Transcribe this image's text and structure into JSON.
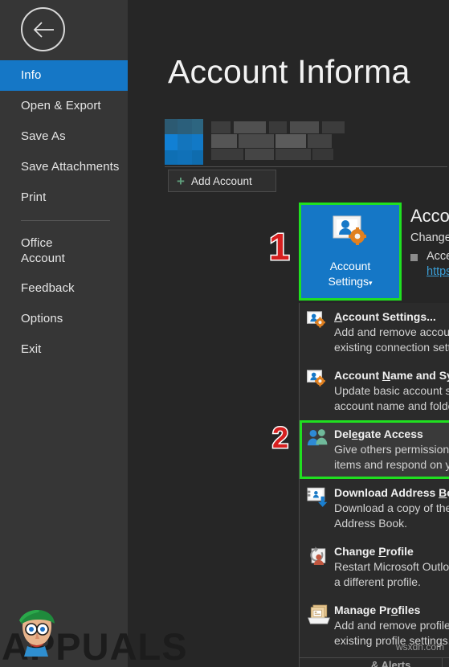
{
  "sidebar": {
    "back_icon": "back-arrow-icon",
    "items": [
      {
        "label": "Info",
        "selected": true
      },
      {
        "label": "Open & Export",
        "selected": false
      },
      {
        "label": "Save As",
        "selected": false
      },
      {
        "label": "Save Attachments",
        "selected": false
      },
      {
        "label": "Print",
        "selected": false
      },
      {
        "separator": true
      },
      {
        "label": "Office Account",
        "selected": false,
        "two_line": true
      },
      {
        "label": "Feedback",
        "selected": false
      },
      {
        "label": "Options",
        "selected": false
      },
      {
        "label": "Exit",
        "selected": false
      }
    ]
  },
  "main": {
    "page_title": "Account Informa",
    "add_account": {
      "label": "Add Account",
      "icon": "plus-icon"
    },
    "tile": {
      "label_line1": "Account",
      "label_line2": "Settings",
      "caret": "▾",
      "icon": "account-settings-icon",
      "bg_color": "#1577c6"
    },
    "account_settings_desc": {
      "heading": "Account Settings",
      "paragraph": "Change settings for this accoun",
      "bullet": "Access this account on the",
      "link": "https://outlook.live.com/o"
    },
    "markers": [
      {
        "text": "1",
        "color": "#d61f1f"
      },
      {
        "text": "2",
        "color": "#d61f1f"
      }
    ],
    "highlight_color": "#20e020"
  },
  "dropdown": {
    "items": [
      {
        "title_before": "",
        "title_accel": "A",
        "title_after": "ccount Settings...",
        "desc_line1": "Add and remove accounts or change",
        "desc_line2": "existing connection settings.",
        "icon": "account-settings-icon",
        "highlighted": false
      },
      {
        "title_before": "Account ",
        "title_accel": "N",
        "title_after": "ame and Sync Settings",
        "desc_line1": "Update basic account settings such as",
        "desc_line2": "account name and folder sync settings.",
        "icon": "account-sync-icon",
        "highlighted": false
      },
      {
        "title_before": "Del",
        "title_accel": "e",
        "title_after": "gate Access",
        "desc_line1": "Give others permission to receive",
        "desc_line2": "items and respond on your behalf.",
        "icon": "delegate-access-icon",
        "highlighted": true
      },
      {
        "title_before": "Download Address ",
        "title_accel": "B",
        "title_after": "ook...",
        "desc_line1": "Download a copy of the Global",
        "desc_line2": "Address Book.",
        "icon": "download-address-book-icon",
        "highlighted": false
      },
      {
        "title_before": "Change ",
        "title_accel": "P",
        "title_after": "rofile",
        "desc_line1": "Restart Microsoft Outlook and choose",
        "desc_line2": "a different profile.",
        "icon": "change-profile-icon",
        "highlighted": false
      },
      {
        "title_before": "Manage Pr",
        "title_accel": "o",
        "title_after": "files",
        "desc_line1": "Add and remove profiles or change",
        "desc_line2": "existing profile settings.",
        "icon": "manage-profiles-icon",
        "highlighted": false
      }
    ]
  },
  "bottom_strip": {
    "text": "& Alerts"
  },
  "watermarks": {
    "appuals": "APPUALS",
    "wsxdn": "wsxdn.com"
  }
}
